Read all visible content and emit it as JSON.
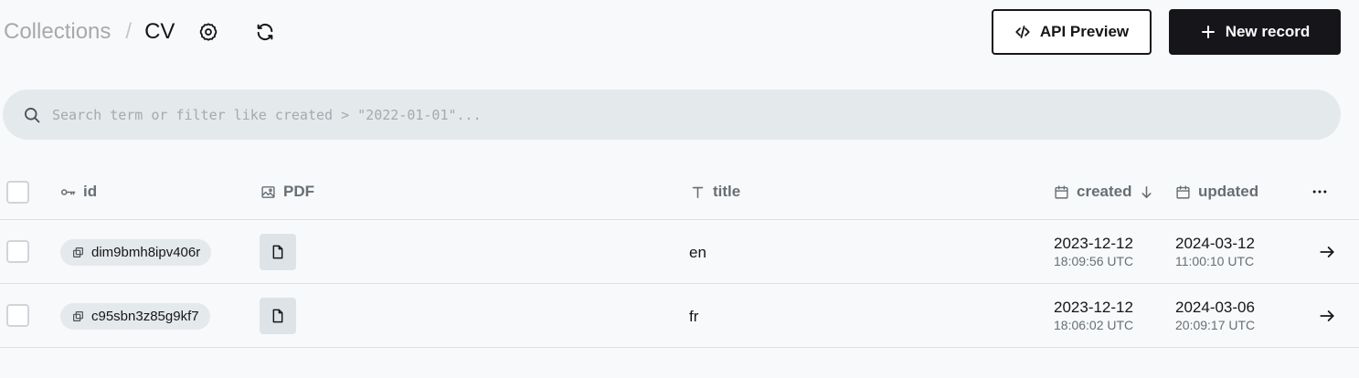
{
  "header": {
    "breadcrumb_parent": "Collections",
    "breadcrumb_separator": "/",
    "breadcrumb_current": "CV",
    "api_preview_label": "API Preview",
    "new_record_label": "New record"
  },
  "search": {
    "placeholder": "Search term or filter like created > \"2022-01-01\"...",
    "value": ""
  },
  "table": {
    "columns": {
      "id": "id",
      "pdf": "PDF",
      "title": "title",
      "created": "created",
      "updated": "updated"
    },
    "sort": {
      "column": "created",
      "direction": "desc"
    },
    "rows": [
      {
        "id": "dim9bmh8ipv406r",
        "title": "en",
        "created_date": "2023-12-12",
        "created_time": "18:09:56 UTC",
        "updated_date": "2024-03-12",
        "updated_time": "11:00:10 UTC"
      },
      {
        "id": "c95sbn3z85g9kf7",
        "title": "fr",
        "created_date": "2023-12-12",
        "created_time": "18:06:02 UTC",
        "updated_date": "2024-03-06",
        "updated_time": "20:09:17 UTC"
      }
    ]
  },
  "colors": {
    "background": "#f8f9fa",
    "text": "#16161a",
    "muted": "#666f75",
    "search_bg": "#e4e9ec",
    "primary_button": "#16161a"
  },
  "icons": {
    "settings": "gear-icon",
    "refresh": "refresh-icon",
    "api_preview": "code-icon",
    "new_record": "plus-icon",
    "search": "search-icon",
    "id_column": "key-icon",
    "pdf_column": "image-icon",
    "title_column": "text-icon",
    "date_columns": "calendar-icon",
    "sort": "arrow-down-icon",
    "copy": "copy-icon",
    "file": "file-icon",
    "open_row": "arrow-right-icon",
    "more": "more-icon"
  }
}
